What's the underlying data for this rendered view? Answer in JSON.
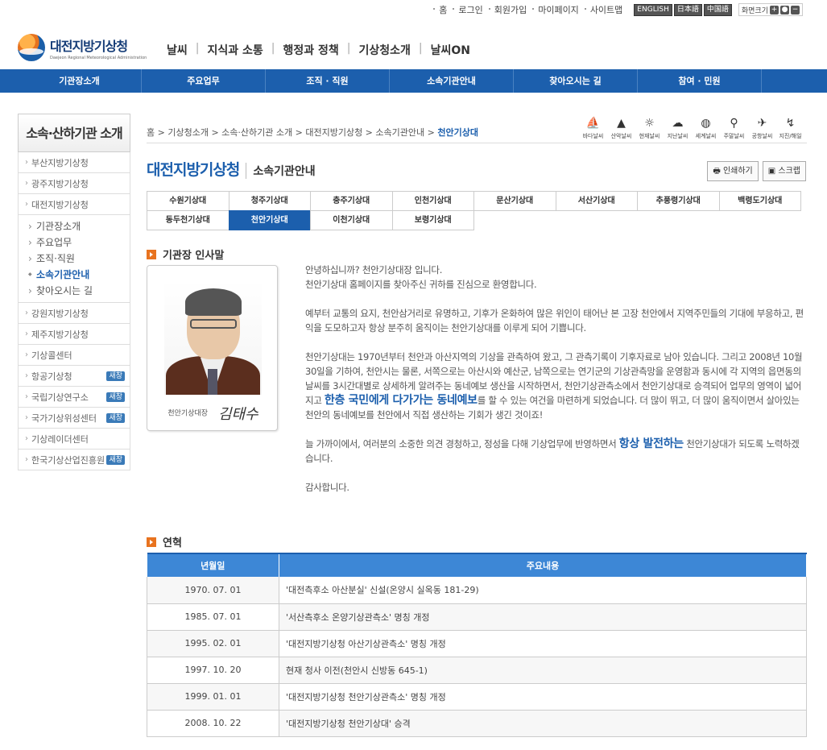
{
  "util": {
    "links": [
      "홈",
      "로그인",
      "회원가입",
      "마이페이지",
      "사이트맵"
    ],
    "langs": [
      "ENGLISH",
      "日本語",
      "中国語"
    ],
    "zoom_label": "화면크기"
  },
  "logo": {
    "kr": "대전지방기상청",
    "en": "Daejeon Regional Meteorological Administration"
  },
  "gnb": [
    "날씨",
    "지식과 소통",
    "행정과 정책",
    "기상청소개",
    "날씨ON"
  ],
  "bar": [
    "기관장소개",
    "주요업무",
    "조직 · 직원",
    "소속기관안내",
    "찾아오시는 길",
    "참여 · 민원"
  ],
  "lnb": {
    "title": "소속·산하기관 소개",
    "top": [
      "부산지방기상청",
      "광주지방기상청"
    ],
    "parent": "대전지방기상청",
    "sub": [
      "기관장소개",
      "주요업무",
      "조직·직원",
      "소속기관안내",
      "찾아오시는 길"
    ],
    "rest": [
      {
        "label": "강원지방기상청",
        "new": ""
      },
      {
        "label": "제주지방기상청",
        "new": ""
      },
      {
        "label": "기상콜센터",
        "new": ""
      },
      {
        "label": "항공기상청",
        "new": "새창"
      },
      {
        "label": "국립기상연구소",
        "new": "새창"
      },
      {
        "label": "국가기상위성센터",
        "new": "새창"
      },
      {
        "label": "기상레이더센터",
        "new": ""
      },
      {
        "label": "한국기상산업진흥원",
        "new": "새창"
      }
    ]
  },
  "breadcrumb": [
    "홈",
    "기상청소개",
    "소속·산하기관 소개",
    "대전지방기상청",
    "소속기관안내",
    "천안기상대"
  ],
  "quick": [
    {
      "icon": "ship-icon",
      "g": "⛵",
      "label": "바다날씨"
    },
    {
      "icon": "mountain-icon",
      "g": "▲",
      "label": "산악날씨"
    },
    {
      "icon": "weather-icon",
      "g": "☼",
      "label": "현재날씨"
    },
    {
      "icon": "past-weather-icon",
      "g": "☁",
      "label": "지난날씨"
    },
    {
      "icon": "globe-icon",
      "g": "◍",
      "label": "세계날씨"
    },
    {
      "icon": "bike-icon",
      "g": "⚲",
      "label": "주말날씨"
    },
    {
      "icon": "plane-icon",
      "g": "✈",
      "label": "공항날씨"
    },
    {
      "icon": "quake-icon",
      "g": "↯",
      "label": "지진/해일"
    }
  ],
  "title": {
    "main": "대전지방기상청",
    "sub": "소속기관안내"
  },
  "tools": {
    "print": "인쇄하기",
    "scrap": "스크랩"
  },
  "tabs": [
    [
      "수원기상대",
      "청주기상대",
      "충주기상대",
      "인천기상대",
      "문산기상대",
      "서산기상대",
      "추풍령기상대",
      "백령도기상대"
    ],
    [
      "동두천기상대",
      "천안기상대",
      "이천기상대",
      "보령기상대"
    ]
  ],
  "section1": "기관장 인사말",
  "photo_caption": {
    "role": "천안기상대장",
    "signature": "김태수"
  },
  "greeting": {
    "p1": "안녕하십니까? 천안기상대장 입니다.",
    "p1b": "천안기상대 홈페이지를 찾아주신 귀하를 진심으로 환영합니다.",
    "p2": "예부터 교통의 요지, 천안삼거리로 유명하고, 기후가 온화하여 많은 위인이 태어난 본 고장 천안에서 지역주민들의 기대에 부응하고, 편익을 도모하고자 항상 분주히 움직이는 천안기상대를 이루게 되어 기쁩니다.",
    "p3a": "천안기상대는 1970년부터 천안과 아산지역의 기상을 관측하여 왔고, 그 관측기록이 기후자료로 남아 있습니다. 그리고 2008년 10월 30일을 기하여, 천안시는 물론, 서쪽으로는 아산시와 예산군, 남쪽으로는 연기군의 기상관측망을 운영함과 동시에 각 지역의 읍면동의 날씨를 3시간대별로 상세하게 알려주는 동네예보 생산을 시작하면서, 천안기상관측소에서 천안기상대로 승격되어 업무의 영역이 넓어지고 ",
    "p3em": "한층 국민에게 다가가는 동네예보",
    "p3b": "를 할 수 있는 여건을 마련하게 되었습니다. 더 많이 뛰고, 더 많이 움직이면서 살아있는 천안의 동네예보를 천안에서 직접 생산하는 기회가 생긴 것이죠!",
    "p4a": "늘 가까이에서, 여러분의 소중한 의견 경청하고, 정성을 다해 기상업무에 반영하면서 ",
    "p4em": "항상 발전하는",
    "p4b": " 천안기상대가 되도록 노력하겠습니다.",
    "p5": "감사합니다."
  },
  "section2": "연혁",
  "history": {
    "headers": [
      "년월일",
      "주요내용"
    ],
    "rows": [
      [
        "1970. 07. 01",
        "'대전측후소 아산분실' 신설(온양시 실옥동 181-29)"
      ],
      [
        "1985. 07. 01",
        "'서산측후소 온양기상관측소' 명칭 개정"
      ],
      [
        "1995. 02. 01",
        "'대전지방기상청 아산기상관측소' 명칭 개정"
      ],
      [
        "1997. 10. 20",
        "현재 청사 이전(천안시 신방동 645-1)"
      ],
      [
        "1999. 01. 01",
        "'대전지방기상청 천안기상관측소' 명칭 개정"
      ],
      [
        "2008. 10. 22",
        "'대전지방기상청 천안기상대' 승격"
      ]
    ]
  }
}
